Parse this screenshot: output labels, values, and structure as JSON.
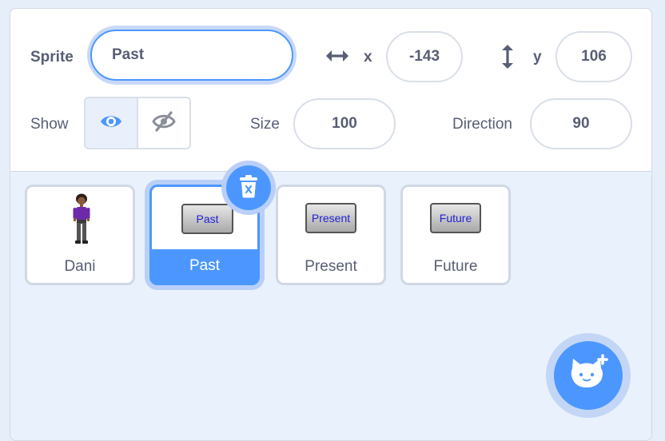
{
  "info": {
    "sprite_label": "Sprite",
    "sprite_name": "Past",
    "x_label": "x",
    "x_value": "-143",
    "y_label": "y",
    "y_value": "106",
    "show_label": "Show",
    "size_label": "Size",
    "size_value": "100",
    "direction_label": "Direction",
    "direction_value": "90"
  },
  "sprites": [
    {
      "name": "Dani",
      "thumb": "character",
      "selected": false
    },
    {
      "name": "Past",
      "thumb": "Past",
      "selected": true
    },
    {
      "name": "Present",
      "thumb": "Present",
      "selected": false
    },
    {
      "name": "Future",
      "thumb": "Future",
      "selected": false
    }
  ],
  "icons": {
    "x_icon": "horizontal-arrows-icon",
    "y_icon": "vertical-arrows-icon",
    "show_visible": "eye-icon",
    "show_hidden": "eye-slash-icon",
    "delete": "trash-icon",
    "add_sprite": "cat-add-icon"
  },
  "colors": {
    "accent": "#4c97ff",
    "accent_halo": "#b9cff7",
    "text": "#575e75",
    "panel_bg": "#e9f1fc",
    "thumb_text": "#2222d6"
  }
}
